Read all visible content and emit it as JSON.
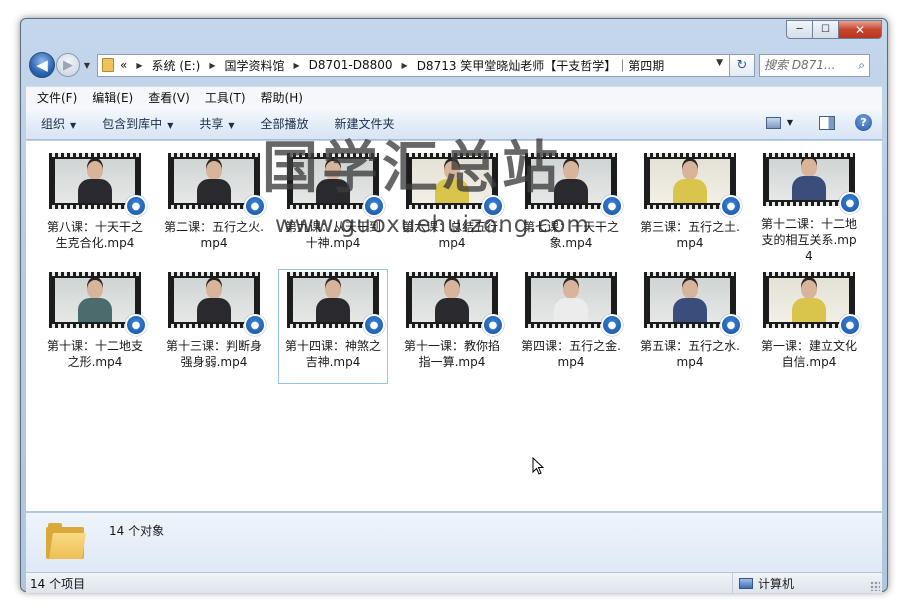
{
  "window": {
    "buttons": {
      "minimize": "─",
      "maximize": "☐",
      "close": "✕"
    }
  },
  "navigation": {
    "back_glyph": "◀",
    "forward_glyph": "▶",
    "overflow": "«",
    "crumbs": [
      "系统 (E:)",
      "国学资料馆",
      "D8701-D8800",
      "D8713 笑甲堂晓灿老师【干支哲学】｜第四期"
    ],
    "refresh_glyph": "↻",
    "search_placeholder": "搜索 D871..."
  },
  "menu": [
    "文件(F)",
    "编辑(E)",
    "查看(V)",
    "工具(T)",
    "帮助(H)"
  ],
  "toolbar": {
    "organize": "组织",
    "include_library": "包含到库中",
    "share": "共享",
    "play_all": "全部播放",
    "new_folder": "新建文件夹",
    "help_glyph": "?"
  },
  "files": [
    {
      "name": "第八课：十天干之生克合化.mp4",
      "outfit": "dark",
      "bg": "grey"
    },
    {
      "name": "第二课：五行之火.mp4",
      "outfit": "dark",
      "bg": "grey"
    },
    {
      "name": "第九课：从天干到十神.mp4",
      "outfit": "dark",
      "bg": "grey"
    },
    {
      "name": "第六课：总结五行.mp4",
      "outfit": "yellow",
      "bg": "yellow"
    },
    {
      "name": "第七课：十天干之象.mp4",
      "outfit": "dark",
      "bg": "grey"
    },
    {
      "name": "第三课：五行之土.mp4",
      "outfit": "yellow",
      "bg": "yellow"
    },
    {
      "name": "第十二课：十二地支的相互关系.mp4",
      "outfit": "blue",
      "bg": "grey"
    },
    {
      "name": "第十课：十二地支之形.mp4",
      "outfit": "teal",
      "bg": "grey"
    },
    {
      "name": "第十三课：判断身强身弱.mp4",
      "outfit": "dark",
      "bg": "grey"
    },
    {
      "name": "第十四课：神煞之吉神.mp4",
      "outfit": "dark",
      "bg": "grey",
      "selected": true
    },
    {
      "name": "第十一课：教你掐指一算.mp4",
      "outfit": "dark",
      "bg": "grey"
    },
    {
      "name": "第四课：五行之金.mp4",
      "outfit": "white",
      "bg": "grey"
    },
    {
      "name": "第五课：五行之水.mp4",
      "outfit": "blue",
      "bg": "grey"
    },
    {
      "name": "第一课：建立文化自信.mp4",
      "outfit": "yellow",
      "bg": "yellow"
    }
  ],
  "watermark": {
    "main": "国学汇总站",
    "sub": "www.guoxuehuizong.com"
  },
  "details": {
    "count_text": "14 个对象"
  },
  "status": {
    "items": "14 个项目",
    "location": "计算机"
  }
}
